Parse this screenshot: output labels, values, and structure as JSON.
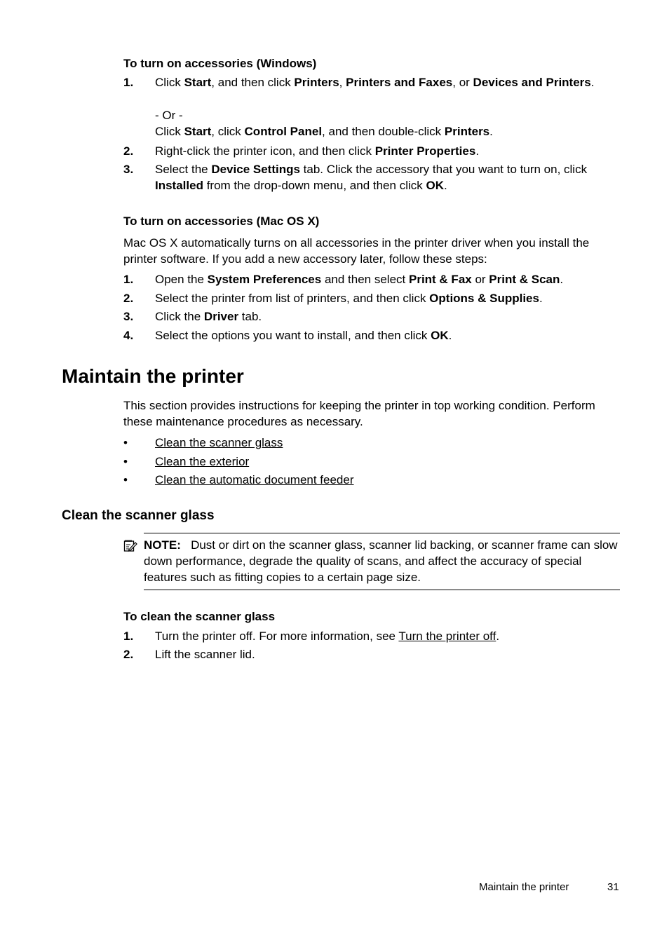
{
  "windows_procedure": {
    "title": "To turn on accessories (Windows)",
    "steps": [
      {
        "num": "1.",
        "parts": [
          [
            "t",
            "Click "
          ],
          [
            "b",
            "Start"
          ],
          [
            "t",
            ", and then click "
          ],
          [
            "b",
            "Printers"
          ],
          [
            "t",
            ", "
          ],
          [
            "b",
            "Printers and Faxes"
          ],
          [
            "t",
            ", or "
          ],
          [
            "b",
            "Devices and Printers"
          ],
          [
            "t",
            "."
          ]
        ]
      },
      {
        "num": "",
        "or_label": "- Or -",
        "parts": [
          [
            "t",
            "Click "
          ],
          [
            "b",
            "Start"
          ],
          [
            "t",
            ", click "
          ],
          [
            "b",
            "Control Panel"
          ],
          [
            "t",
            ", and then double-click "
          ],
          [
            "b",
            "Printers"
          ],
          [
            "t",
            "."
          ]
        ]
      },
      {
        "num": "2.",
        "parts": [
          [
            "t",
            "Right-click the printer icon, and then click "
          ],
          [
            "b",
            "Printer Properties"
          ],
          [
            "t",
            "."
          ]
        ]
      },
      {
        "num": "3.",
        "parts": [
          [
            "t",
            "Select the "
          ],
          [
            "b",
            "Device Settings"
          ],
          [
            "t",
            " tab. Click the accessory that you want to turn on, click "
          ],
          [
            "b",
            "Installed"
          ],
          [
            "t",
            " from the drop-down menu, and then click "
          ],
          [
            "b",
            "OK"
          ],
          [
            "t",
            "."
          ]
        ]
      }
    ]
  },
  "mac_procedure": {
    "title": "To turn on accessories (Mac OS X)",
    "intro": "Mac OS X automatically turns on all accessories in the printer driver when you install the printer software. If you add a new accessory later, follow these steps:",
    "steps": [
      {
        "num": "1.",
        "parts": [
          [
            "t",
            "Open the "
          ],
          [
            "b",
            "System Preferences"
          ],
          [
            "t",
            " and then select "
          ],
          [
            "b",
            "Print & Fax"
          ],
          [
            "t",
            " or "
          ],
          [
            "b",
            "Print & Scan"
          ],
          [
            "t",
            "."
          ]
        ]
      },
      {
        "num": "2.",
        "parts": [
          [
            "t",
            "Select the printer from list of printers, and then click "
          ],
          [
            "b",
            "Options & Supplies"
          ],
          [
            "t",
            "."
          ]
        ]
      },
      {
        "num": "3.",
        "parts": [
          [
            "t",
            "Click the "
          ],
          [
            "b",
            "Driver"
          ],
          [
            "t",
            " tab."
          ]
        ]
      },
      {
        "num": "4.",
        "parts": [
          [
            "t",
            "Select the options you want to install, and then click "
          ],
          [
            "b",
            "OK"
          ],
          [
            "t",
            "."
          ]
        ]
      }
    ]
  },
  "section": {
    "title": "Maintain the printer",
    "intro": "This section provides instructions for keeping the printer in top working condition. Perform these maintenance procedures as necessary.",
    "links": [
      "Clean the scanner glass",
      "Clean the exterior",
      "Clean the automatic document feeder"
    ],
    "bullet": "•"
  },
  "subsection": {
    "title": "Clean the scanner glass",
    "note_label": "NOTE:",
    "note_text": "Dust or dirt on the scanner glass, scanner lid backing, or scanner frame can slow down performance, degrade the quality of scans, and affect the accuracy of special features such as fitting copies to a certain page size.",
    "note_icon": "note-pencil-icon",
    "procedure_title": "To clean the scanner glass",
    "steps": [
      {
        "num": "1.",
        "text": "Turn the printer off. For more information, see ",
        "link": "Turn the printer off",
        "after": "."
      },
      {
        "num": "2.",
        "text": "Lift the scanner lid."
      }
    ]
  },
  "footer": {
    "section_name": "Maintain the printer",
    "page_number": "31"
  }
}
